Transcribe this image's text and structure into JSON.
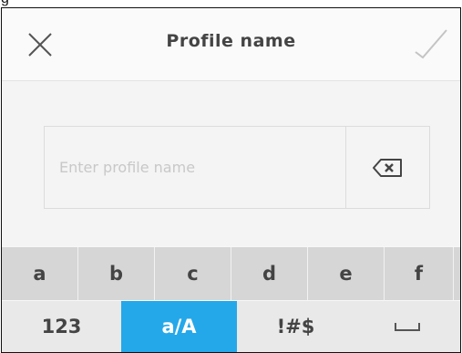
{
  "caption": "g",
  "header": {
    "title": "Profile name",
    "close_icon": "close-icon",
    "confirm_icon": "check-icon"
  },
  "input": {
    "placeholder": "Enter profile name",
    "value": "",
    "clear_icon": "backspace-icon"
  },
  "keyboard": {
    "letters": [
      "a",
      "b",
      "c",
      "d",
      "e",
      "f"
    ],
    "modes": [
      {
        "label": "123",
        "active": false
      },
      {
        "label": "a/A",
        "active": true
      },
      {
        "label": "!#$",
        "active": false
      },
      {
        "label": "",
        "icon": "space-icon",
        "active": false
      }
    ]
  },
  "colors": {
    "accent": "#24a8ea",
    "key_row": "#d6d6d6",
    "bottom_row": "#e9e9e9",
    "text": "#444444",
    "placeholder": "#c8c8c8"
  }
}
